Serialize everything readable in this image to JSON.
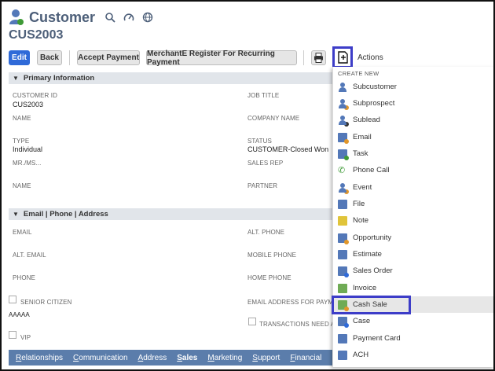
{
  "header": {
    "record_type": "Customer",
    "record_id": "CUS2003",
    "tools": [
      "search-icon",
      "gauge-icon",
      "globe-icon"
    ]
  },
  "toolbar": {
    "edit": "Edit",
    "back": "Back",
    "accept_payment": "Accept Payment",
    "merchant_register": "MerchantE Register For Recurring Payment",
    "actions": "Actions"
  },
  "primary": {
    "title": "Primary Information",
    "customer_id_label": "CUSTOMER ID",
    "customer_id": "CUS2003",
    "job_title_label": "JOB TITLE",
    "name_label": "NAME",
    "company_name_label": "COMPANY NAME",
    "type_label": "TYPE",
    "type": "Individual",
    "status_label": "STATUS",
    "status": "CUSTOMER-Closed Won",
    "mr_ms_label": "MR./MS...",
    "sales_rep_label": "SALES REP",
    "name2_label": "NAME",
    "partner_label": "PARTNER"
  },
  "contact": {
    "title": "Email | Phone | Address",
    "email_label": "EMAIL",
    "alt_phone_label": "ALT. PHONE",
    "alt_email_label": "ALT. EMAIL",
    "mobile_phone_label": "MOBILE PHONE",
    "phone_label": "PHONE",
    "home_phone_label": "HOME PHONE",
    "senior_citizen_label": "SENIOR CITIZEN",
    "email_for_payment_label": "EMAIL ADDRESS FOR PAYME",
    "aaaaa": "AAAAA",
    "transactions_need_label": "TRANSACTIONS NEED AP",
    "vip_label": "VIP"
  },
  "subtabs": [
    "Relationships",
    "Communication",
    "Address",
    "Sales",
    "Marketing",
    "Support",
    "Financial"
  ],
  "menu": {
    "header": "CREATE NEW",
    "items": [
      {
        "label": "Subcustomer",
        "icon": "person-icon"
      },
      {
        "label": "Subprospect",
        "icon": "person-icon"
      },
      {
        "label": "Sublead",
        "icon": "person-icon"
      },
      {
        "label": "Email",
        "icon": "email-icon"
      },
      {
        "label": "Task",
        "icon": "task-icon"
      },
      {
        "label": "Phone Call",
        "icon": "phone-icon"
      },
      {
        "label": "Event",
        "icon": "event-icon"
      },
      {
        "label": "File",
        "icon": "file-icon"
      },
      {
        "label": "Note",
        "icon": "note-icon"
      },
      {
        "label": "Opportunity",
        "icon": "opportunity-icon"
      },
      {
        "label": "Estimate",
        "icon": "estimate-icon"
      },
      {
        "label": "Sales Order",
        "icon": "sales-order-icon"
      },
      {
        "label": "Invoice",
        "icon": "invoice-icon"
      },
      {
        "label": "Cash Sale",
        "icon": "cash-sale-icon"
      },
      {
        "label": "Case",
        "icon": "case-icon"
      },
      {
        "label": "Payment Card",
        "icon": "payment-card-icon"
      },
      {
        "label": "ACH",
        "icon": "ach-icon"
      }
    ]
  },
  "colors": {
    "title": "#4d5f79",
    "edit_button": "#2f6ad8",
    "subtab_bar": "#5b7dab",
    "highlight_border": "#3d3dc8",
    "section_bar": "#e1e5ea"
  }
}
